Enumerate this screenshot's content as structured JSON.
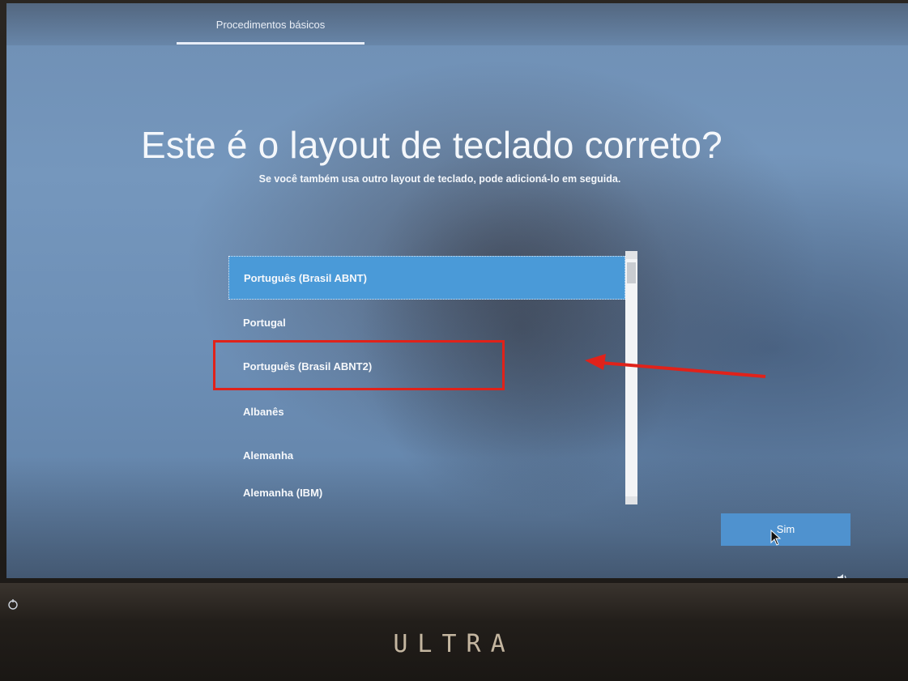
{
  "header": {
    "tab_label": "Procedimentos básicos"
  },
  "main": {
    "title": "Este é o layout de teclado correto?",
    "subtitle": "Se você também usa outro layout de teclado, pode adicioná-lo em seguida."
  },
  "layouts": {
    "items": [
      {
        "label": "Português (Brasil ABNT)",
        "selected": true
      },
      {
        "label": "Portugal",
        "selected": false
      },
      {
        "label": "Português (Brasil ABNT2)",
        "selected": false
      },
      {
        "label": "Albanês",
        "selected": false
      },
      {
        "label": "Alemanha",
        "selected": false
      },
      {
        "label": "Alemanha (IBM)",
        "selected": false
      }
    ]
  },
  "footer": {
    "confirm_label": "Sim",
    "volume_icon": "volume-icon",
    "power_icon": "ease-of-access-icon"
  },
  "device": {
    "brand_label": "ULTRA"
  },
  "colors": {
    "selection": "#4a9ad8",
    "annotation": "#e0221a",
    "button": "#4f92cf"
  }
}
